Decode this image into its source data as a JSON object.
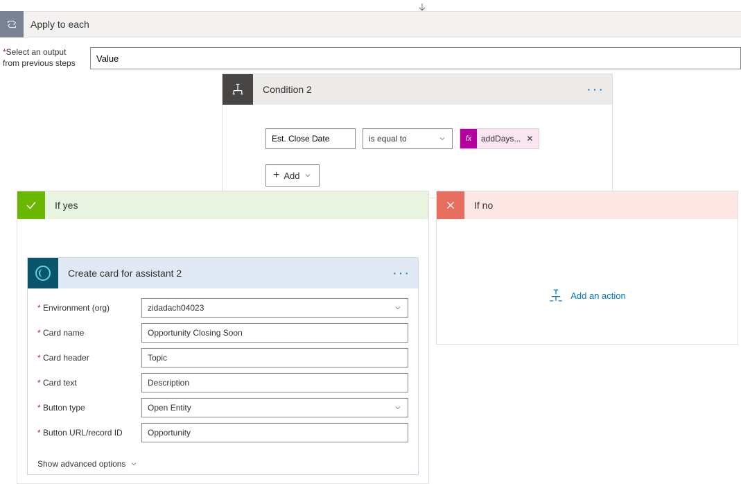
{
  "top_connector": "↓",
  "apply_each": {
    "title": "Apply to each"
  },
  "output_label_line1": "Select an output",
  "output_label_line2": "from previous steps",
  "output_value": "Value",
  "condition": {
    "title": "Condition 2",
    "field": "Est. Close Date",
    "operator": "is equal to",
    "fx_label": "addDays...",
    "add_label": "Add"
  },
  "branches": {
    "yes": {
      "title": "If yes",
      "action": {
        "title": "Create card for assistant 2",
        "fields": [
          {
            "label": "Environment (org)",
            "value": "zidadach04023",
            "select": true
          },
          {
            "label": "Card name",
            "value": "Opportunity Closing Soon",
            "select": false
          },
          {
            "label": "Card header",
            "value": "Topic",
            "select": false
          },
          {
            "label": "Card text",
            "value": "Description",
            "select": false
          },
          {
            "label": "Button type",
            "value": "Open Entity",
            "select": true
          },
          {
            "label": "Button URL/record ID",
            "value": "Opportunity",
            "select": false
          }
        ],
        "advanced": "Show advanced options"
      }
    },
    "no": {
      "title": "If no",
      "add_action": "Add an action"
    }
  }
}
